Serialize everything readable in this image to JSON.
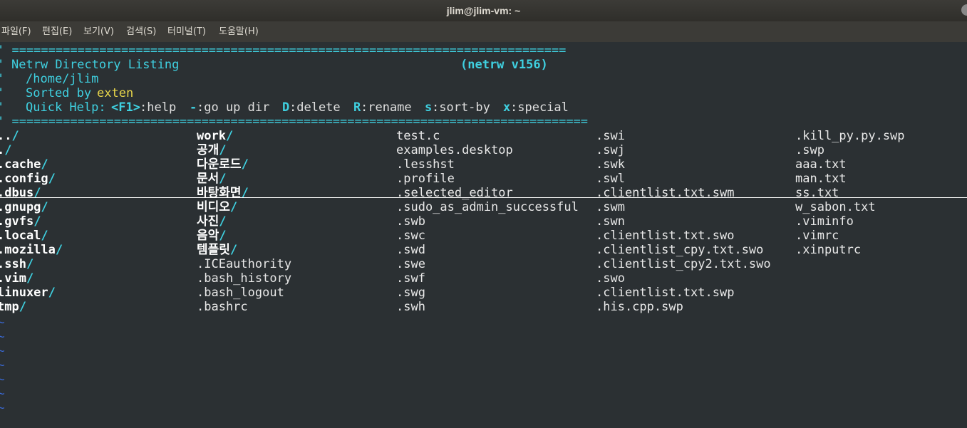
{
  "window": {
    "title": "jlim@jlim-vm: ~"
  },
  "menu": [
    "파일(F)",
    "편집(E)",
    "보기(V)",
    "검색(S)",
    "터미널(T)",
    "도움말(H)"
  ],
  "header": {
    "sep1": "' ============================================================================",
    "quote": "'",
    "title": "Netrw Directory Listing",
    "version": "(netrw v156)",
    "path": "/home/jlim",
    "sorted_label": "Sorted by",
    "sorted_value": "exten",
    "quick_help_label": "Quick Help:",
    "help": [
      {
        "key": "<F1>",
        "desc": ":help"
      },
      {
        "key": "-",
        "desc": ":go up dir"
      },
      {
        "key": "D",
        "desc": ":delete"
      },
      {
        "key": "R",
        "desc": ":rename"
      },
      {
        "key": "s",
        "desc": ":sort-by"
      },
      {
        "key": "x",
        "desc": ":special"
      }
    ],
    "sep2": "' ==============================================================================="
  },
  "columns": [
    [
      "../",
      "./",
      ".cache/",
      ".config/",
      ".dbus/",
      ".gnupg/",
      ".gvfs/",
      ".local/",
      ".mozilla/",
      ".ssh/",
      ".vim/",
      "linuxer/",
      "tmp/"
    ],
    [
      "work/",
      "공개/",
      "다운로드/",
      "문서/",
      "바탕화면/",
      "비디오/",
      "사진/",
      "음악/",
      "템플릿/",
      ".ICEauthority",
      ".bash_history",
      ".bash_logout",
      ".bashrc"
    ],
    [
      "test.c",
      "examples.desktop",
      ".lesshst",
      ".profile",
      ".selected_editor",
      ".sudo_as_admin_successful",
      ".swb",
      ".swc",
      ".swd",
      ".swe",
      ".swf",
      ".swg",
      ".swh"
    ],
    [
      ".swi",
      ".swj",
      ".swk",
      ".swl",
      ".clientlist.txt.swm",
      ".swm",
      ".swn",
      ".clientlist.txt.swo",
      ".clientlist_cpy.txt.swo",
      ".clientlist_cpy2.txt.swo",
      ".swo",
      ".clientlist.txt.swp",
      ".his.cpp.swp"
    ],
    [
      ".kill_py.py.swp",
      ".swp",
      "aaa.txt",
      "man.txt",
      "ss.txt",
      "w_sabon.txt",
      ".viminfo",
      ".vimrc",
      ".xinputrc"
    ]
  ],
  "tilde": "~",
  "colors": {
    "dir": "#ffffff",
    "slash": "#3fd0e0",
    "accent": "#3fd0e0",
    "sort": "#e6d44a",
    "tilde": "#3a6ad9",
    "background": "#2b3033"
  }
}
